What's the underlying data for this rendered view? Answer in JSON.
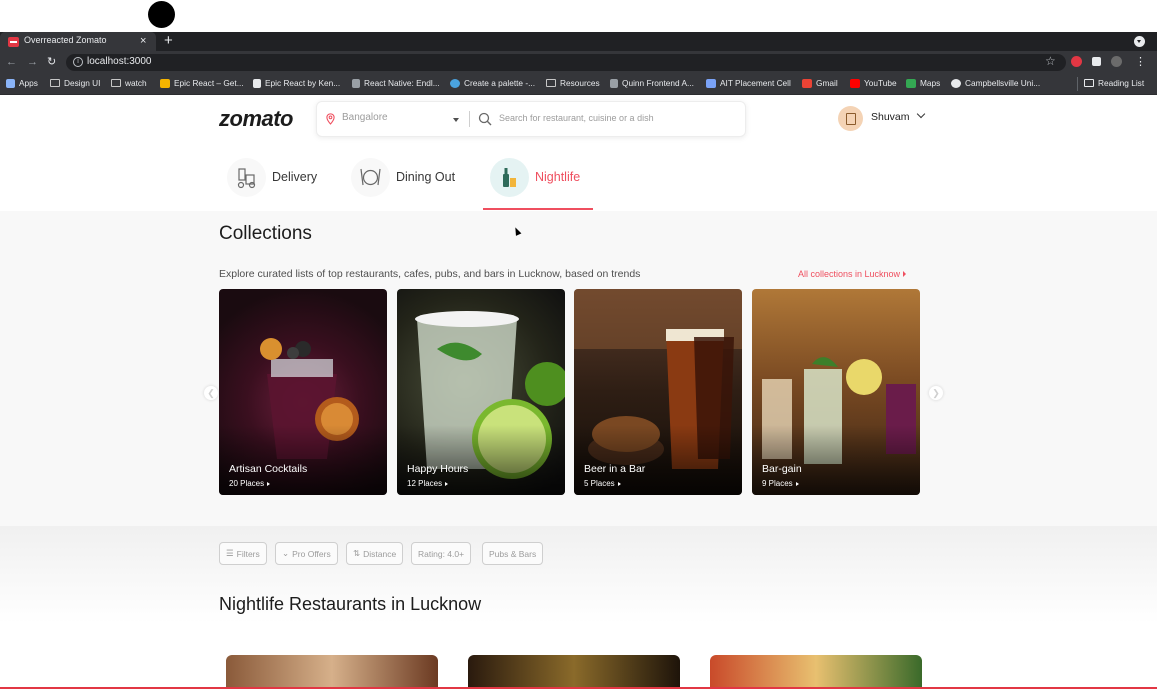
{
  "browser": {
    "tab_title": "Overreacted Zomato",
    "tab_close": "×",
    "new_tab": "+",
    "url": "localhost:3000",
    "bookmarks": [
      {
        "label": "Apps",
        "icon": "apps-grid-icon",
        "color": "#8ab4f8"
      },
      {
        "label": "Design UI",
        "icon": "folder-icon",
        "color": "#c7c7c7"
      },
      {
        "label": "watch",
        "icon": "folder-icon",
        "color": "#c7c7c7"
      },
      {
        "label": "Epic React – Get...",
        "icon": "play-icon",
        "color": "#f5b400"
      },
      {
        "label": "Epic React by Ken...",
        "icon": "download-icon",
        "color": "#e8eaed"
      },
      {
        "label": "React Native: Endl...",
        "icon": "page-icon",
        "color": "#9aa0a6"
      },
      {
        "label": "Create a palette -...",
        "icon": "palette-icon",
        "color": "#4aa3df"
      },
      {
        "label": "Resources",
        "icon": "folder-icon",
        "color": "#c7c7c7"
      },
      {
        "label": "Quinn Frontend A...",
        "icon": "quinn-icon",
        "color": "#9aa0a6"
      },
      {
        "label": "AIT Placement Cell",
        "icon": "ait-icon",
        "color": "#7aa2f7"
      },
      {
        "label": "Gmail",
        "icon": "gmail-icon",
        "color": "#ea4335"
      },
      {
        "label": "YouTube",
        "icon": "youtube-icon",
        "color": "#ff0000"
      },
      {
        "label": "Maps",
        "icon": "maps-icon",
        "color": "#34a853"
      },
      {
        "label": "Campbellsville Uni...",
        "icon": "globe-icon",
        "color": "#e8eaed"
      }
    ],
    "reading_list": "Reading List"
  },
  "header": {
    "logo": "zomato",
    "location": "Bangalore",
    "search_placeholder": "Search for restaurant, cuisine or a dish",
    "user_name": "Shuvam"
  },
  "nav_tabs": [
    {
      "label": "Delivery",
      "active": false
    },
    {
      "label": "Dining Out",
      "active": false
    },
    {
      "label": "Nightlife",
      "active": true
    }
  ],
  "collections": {
    "title": "Collections",
    "subtitle": "Explore curated lists of top restaurants, cafes, pubs, and bars in Lucknow, based on trends",
    "all_link": "All collections in Lucknow",
    "cards": [
      {
        "name": "Artisan Cocktails",
        "places": "20 Places"
      },
      {
        "name": "Happy Hours",
        "places": "12 Places"
      },
      {
        "name": "Beer in a Bar",
        "places": "5 Places"
      },
      {
        "name": "Bar-gain",
        "places": "9 Places"
      }
    ]
  },
  "filters": [
    {
      "label": "Filters",
      "icon": "sliders-icon"
    },
    {
      "label": "Pro Offers",
      "icon": "chevron-down-icon"
    },
    {
      "label": "Distance",
      "icon": "sort-icon"
    },
    {
      "label": "Rating: 4.0+",
      "icon": ""
    },
    {
      "label": "Pubs & Bars",
      "icon": ""
    }
  ],
  "nightlife": {
    "title": "Nightlife Restaurants in Lucknow"
  },
  "colors": {
    "brand": "#e23744",
    "accent": "#ef4f5f",
    "chrome_dark": "#202124",
    "chrome_mid": "#35363a"
  }
}
